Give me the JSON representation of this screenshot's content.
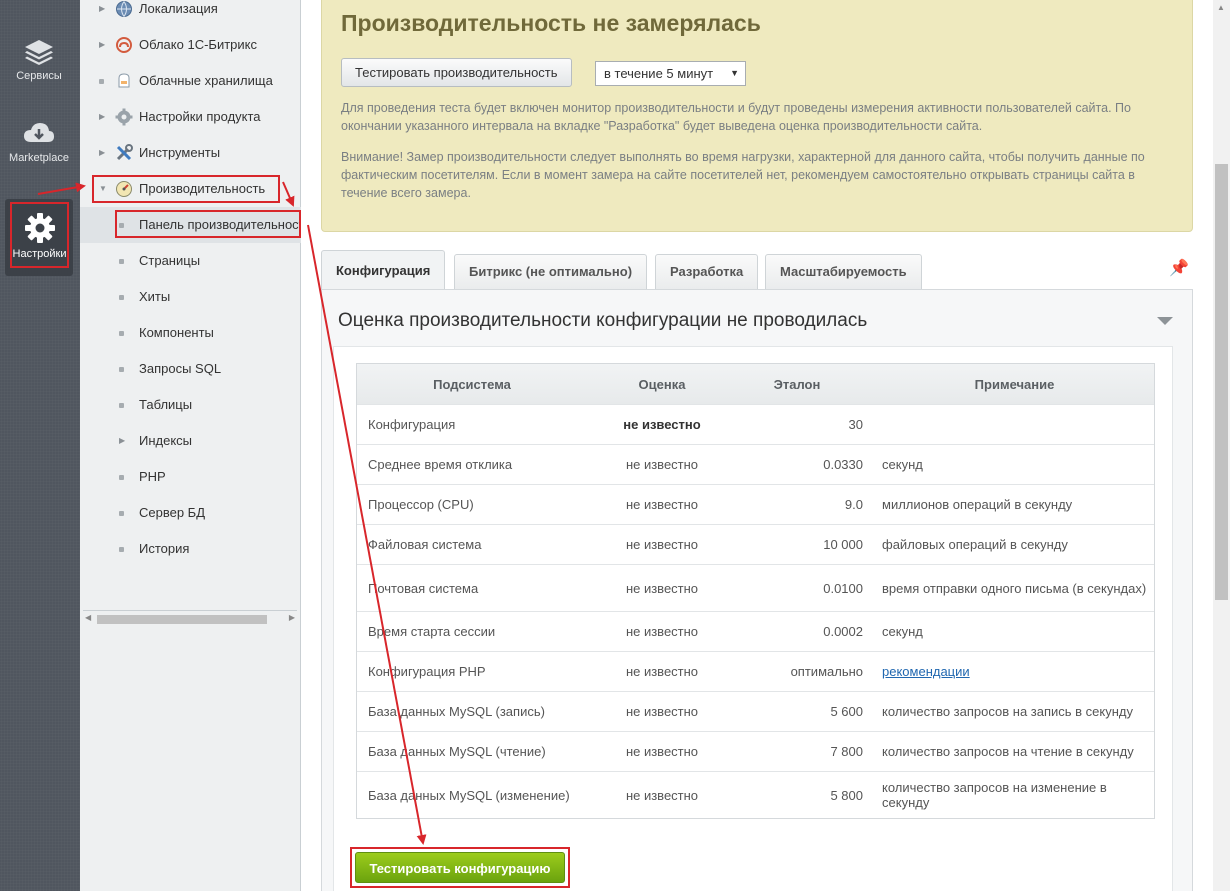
{
  "rail": {
    "items": [
      {
        "label": "Сервисы",
        "icon": "layers-icon"
      },
      {
        "label": "Marketplace",
        "icon": "cloud-download-icon"
      },
      {
        "label": "Настройки",
        "icon": "gear-icon"
      }
    ]
  },
  "menu": {
    "items": [
      {
        "label": "Локализация",
        "icon": "globe-icon"
      },
      {
        "label": "Облако 1С-Битрикс",
        "icon": "cloud-icon"
      },
      {
        "label": "Облачные хранилища",
        "icon": "storage-icon"
      },
      {
        "label": "Настройки продукта",
        "icon": "gear-icon"
      },
      {
        "label": "Инструменты",
        "icon": "tools-icon"
      },
      {
        "label": "Производительность",
        "icon": "gauge-icon"
      },
      {
        "label": "Панель производительности"
      },
      {
        "label": "Страницы"
      },
      {
        "label": "Хиты"
      },
      {
        "label": "Компоненты"
      },
      {
        "label": "Запросы SQL"
      },
      {
        "label": "Таблицы"
      },
      {
        "label": "Индексы"
      },
      {
        "label": "PHP"
      },
      {
        "label": "Сервер БД"
      },
      {
        "label": "История"
      }
    ]
  },
  "perf": {
    "title": "Производительность не замерялась",
    "test_button": "Тестировать производительность",
    "duration_select": "в течение 5 минут",
    "para1": "Для проведения теста будет включен монитор производительности и будут проведены измерения активности пользователей сайта. По окончании указанного интервала на вкладке \"Разработка\" будет выведена оценка производительности сайта.",
    "para2": "Внимание! Замер производительности следует выполнять во время нагрузки, характерной для данного сайта, чтобы получить данные по фактическим посетителям. Если в момент замера на сайте посетителей нет, рекомендуем самостоятельно открывать страницы сайта в течение всего замера."
  },
  "tabs": [
    {
      "label": "Конфигурация"
    },
    {
      "label": "Битрикс (не оптимально)"
    },
    {
      "label": "Разработка"
    },
    {
      "label": "Масштабируемость"
    }
  ],
  "panel": {
    "title": "Оценка производительности конфигурации не проводилась"
  },
  "table": {
    "headers": [
      "Подсистема",
      "Оценка",
      "Эталон",
      "Примечание"
    ],
    "rows": [
      {
        "subsystem": "Конфигурация",
        "score": "не известно",
        "reference": "30",
        "note": ""
      },
      {
        "subsystem": "Среднее время отклика",
        "score": "не известно",
        "reference": "0.0330",
        "note": "секунд"
      },
      {
        "subsystem": "Процессор (CPU)",
        "score": "не известно",
        "reference": "9.0",
        "note": "миллионов операций в секунду"
      },
      {
        "subsystem": "Файловая система",
        "score": "не известно",
        "reference": "10 000",
        "note": "файловых операций в секунду"
      },
      {
        "subsystem": "Почтовая система",
        "score": "не известно",
        "reference": "0.0100",
        "note": "время отправки одного письма (в секундах)"
      },
      {
        "subsystem": "Время старта сессии",
        "score": "не известно",
        "reference": "0.0002",
        "note": "секунд"
      },
      {
        "subsystem": "Конфигурация PHP",
        "score": "не известно",
        "reference": "оптимально",
        "note": "рекомендации"
      },
      {
        "subsystem": "База данных MySQL (запись)",
        "score": "не известно",
        "reference": "5 600",
        "note": "количество запросов на запись в секунду"
      },
      {
        "subsystem": "База данных MySQL (чтение)",
        "score": "не известно",
        "reference": "7 800",
        "note": "количество запросов на чтение в секунду"
      },
      {
        "subsystem": "База данных MySQL (изменение)",
        "score": "не известно",
        "reference": "5 800",
        "note": "количество запросов на изменение в секунду"
      }
    ]
  },
  "actions": {
    "test_config": "Тестировать конфигурацию"
  },
  "colors": {
    "highlight_red": "#d8262b",
    "perf_box_bg": "#efeabf",
    "green_button": "#7fb515",
    "rail_bg": "#50565f"
  }
}
